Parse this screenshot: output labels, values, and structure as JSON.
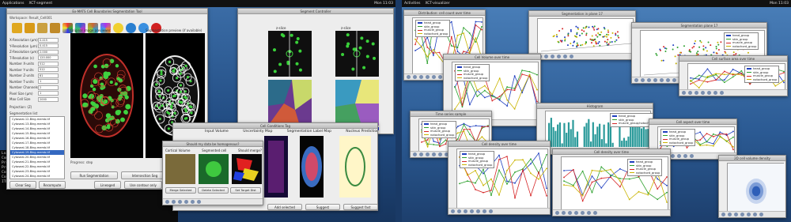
{
  "left_screen": {
    "topbar": {
      "app": "Applications",
      "window": "XCT-segment",
      "right": "Mon 11:03"
    },
    "main_window": {
      "title": "Ex-MATS Cell Boundaries Segmentation Tool",
      "workspace_label": "Workspace",
      "workspace_value": "Result_Cell001",
      "panel_left_title": "Original image previewer",
      "panel_right_title": "Segmentation preview (if available)",
      "params": [
        {
          "label": "X-Resolution (µm)",
          "value": "0.415"
        },
        {
          "label": "Y-Resolution (µm)",
          "value": "0.415"
        },
        {
          "label": "Z-Resolution (µm)",
          "value": "2.000"
        },
        {
          "label": "T-Resolution (s)",
          "value": "120.000"
        },
        {
          "label": "Number X-units",
          "value": "512"
        },
        {
          "label": "Number Y-units",
          "value": "512"
        },
        {
          "label": "Number Z-units",
          "value": "61"
        },
        {
          "label": "Number T-units",
          "value": "1"
        },
        {
          "label": "Number Channels",
          "value": "2"
        },
        {
          "label": "Pixel Size (µm)",
          "value": "1"
        },
        {
          "label": "Max Cell Size",
          "value": "2000"
        }
      ],
      "projection_label": "Projection: (Z)",
      "segmentation_list_label": "Segmentation list",
      "list_items": [
        "Cytoseal-12-Bing.memb.tif",
        "Cytoseal-13-Bing.memb.tif",
        "Cytoseal-14-Bing.memb.tif",
        "Cytoseal-15-Bing.memb.tif",
        "Cytoseal-16-Bing.memb.tif",
        "Cytoseal-17-Bing.memb.tif",
        "Cytoseal-18-Bing.memb.tif",
        "Cytoseal-19-Bing.memb.tif",
        "Cytoseal-20-Bing.memb.tif",
        "Cytoseal-21-Bing.memb.tif",
        "Cytoseal-22-Bing.memb.tif",
        "Cytoseal-23-Bing.memb.tif",
        "Cytoseal-24-Bing.memb.tif"
      ],
      "selected_index": 7,
      "progress_label": "Progress: step",
      "buttons": {
        "clear_seg": "Clear Seg",
        "recompute": "Recompute",
        "run_segmentation": "Run Segmentation",
        "intersection_seg": "Intersection Seg",
        "lineaged": "Lineaged",
        "use_contour": "Use contour only",
        "use_threshold": "Use threshold (S)"
      }
    },
    "terminal_lines": [
      "Loading...",
      "Computing features...",
      "Processing cell stack 1/61",
      "Processing cell stack 2/61",
      "Control ICT Fibrosis 1.0",
      "Control ICT Fibrosis: Level 10-bp [240, 257, 13]",
      "ITK 4.2.1 / ITKTP"
    ],
    "seg_window": {
      "title": "Segment Controller",
      "labels": [
        "z-slice",
        "z-slice"
      ]
    },
    "dialog": {
      "title": "Cell Conditions Tag",
      "question": "Should my data be homogenous?",
      "headers": [
        "Input Volume",
        "Uncertainty Map",
        "Segmentation Label Map",
        "Nucleus Prediction"
      ],
      "subheads": [
        "Cortical Volume",
        "Segmented cell",
        "Should merge?"
      ],
      "small_buttons": [
        "Merge Selected",
        "Delete Selected",
        "Set Target Dist"
      ],
      "bottom_buttons": [
        "Add selected",
        "Suggest",
        "Suggest fast"
      ]
    }
  },
  "right_screen": {
    "topbar": {
      "left": "Activities",
      "window": "XCT-visualizer",
      "right": "Mon 11:03"
    },
    "plots": [
      {
        "title": "Distribution: cell count over time",
        "legend": [
          "head_group",
          "skin_group",
          "muscle_group",
          "notochord_group"
        ]
      },
      {
        "title": "Cell Volume over time",
        "legend": [
          "head_group",
          "skin_group",
          "muscle_group",
          "notochord_group"
        ]
      },
      {
        "title": "Segmentation in plane 17",
        "legend": []
      },
      {
        "title": "Segmentation plane 17",
        "legend": [
          "head_group",
          "skin_group",
          "muscle_group",
          "notochord_group"
        ]
      },
      {
        "title": "Time series sample",
        "legend": [
          "head_group",
          "skin_group",
          "muscle_group",
          "notochord_group"
        ]
      },
      {
        "title": "Histogram",
        "legend": [
          "head_group",
          "skin_group",
          "muscle_group/notochord_group"
        ]
      },
      {
        "title": "Cell surface area over time",
        "legend": [
          "head_group",
          "skin_group",
          "muscle_group",
          "notochord_group"
        ]
      },
      {
        "title": "Cell aspect over time",
        "legend": [
          "head_group",
          "skin_group",
          "muscle_group",
          "notochord_group"
        ]
      },
      {
        "title": "Cell density over time",
        "legend": [
          "head_group",
          "skin_group",
          "muscle_group",
          "notochord_group"
        ]
      },
      {
        "title": "2D cell volume density",
        "legend": []
      }
    ]
  },
  "colors": {
    "head": "#1f3fbf",
    "skin": "#2ca02c",
    "muscle": "#d62728",
    "notochord": "#c9b400"
  }
}
